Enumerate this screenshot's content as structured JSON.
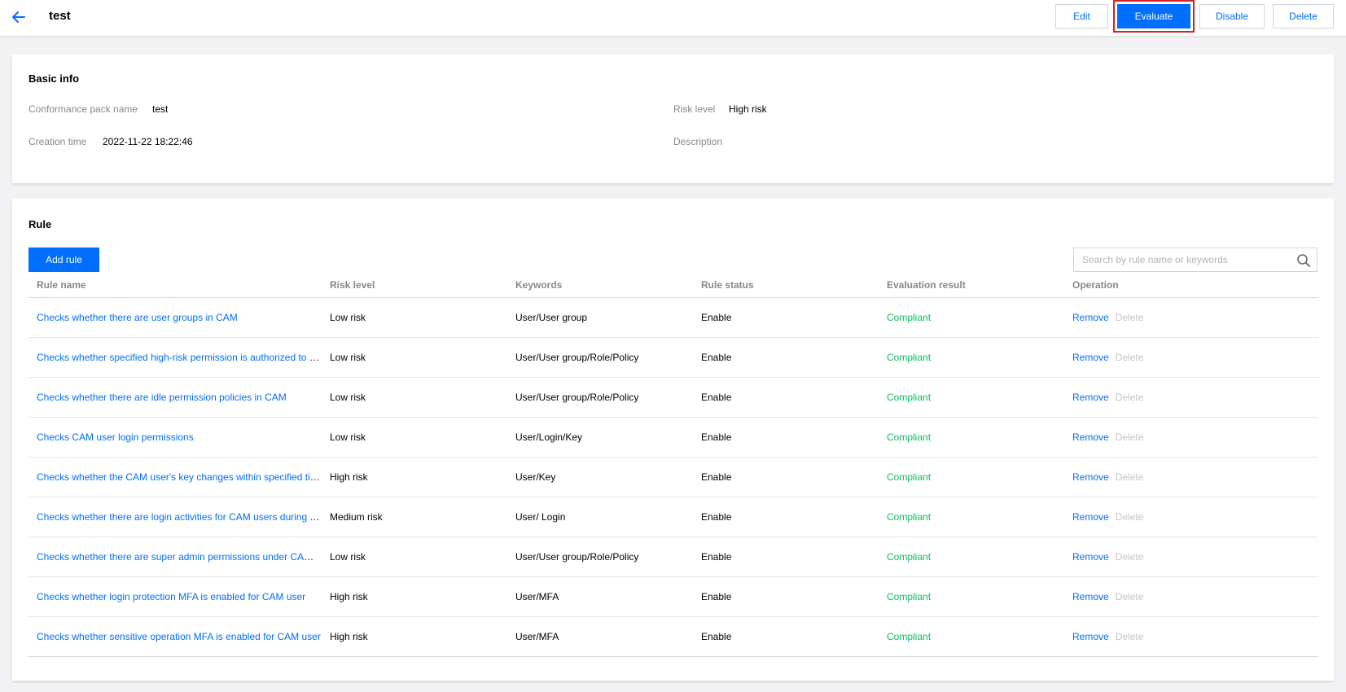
{
  "header": {
    "title": "test",
    "buttons": {
      "edit": "Edit",
      "evaluate": "Evaluate",
      "disable": "Disable",
      "delete": "Delete"
    }
  },
  "basic_info": {
    "title": "Basic info",
    "pack_name_label": "Conformance pack name",
    "pack_name_value": "test",
    "risk_level_label": "Risk level",
    "risk_level_value": "High risk",
    "creation_time_label": "Creation time",
    "creation_time_value": "2022-11-22 18:22:46",
    "description_label": "Description"
  },
  "rule_section": {
    "title": "Rule",
    "add_rule_label": "Add rule",
    "search_placeholder": "Search by rule name or keywords",
    "columns": [
      "Rule name",
      "Risk level",
      "Keywords",
      "Rule status",
      "Evaluation result",
      "Operation"
    ],
    "remove_label": "Remove",
    "delete_label": "Delete",
    "rows": [
      {
        "name": "Checks whether there are user groups in CAM",
        "risk": "Low risk",
        "keywords": "User/User group",
        "status": "Enable",
        "result": "Compliant"
      },
      {
        "name": "Checks whether specified high-risk permission is authorized to CA...",
        "risk": "Low risk",
        "keywords": "User/User group/Role/Policy",
        "status": "Enable",
        "result": "Compliant"
      },
      {
        "name": "Checks whether there are idle permission policies in CAM",
        "risk": "Low risk",
        "keywords": "User/User group/Role/Policy",
        "status": "Enable",
        "result": "Compliant"
      },
      {
        "name": "Checks CAM user login permissions",
        "risk": "Low risk",
        "keywords": "User/Login/Key",
        "status": "Enable",
        "result": "Compliant"
      },
      {
        "name": "Checks whether the CAM user's key changes within specified time",
        "risk": "High risk",
        "keywords": "User/Key",
        "status": "Enable",
        "result": "Compliant"
      },
      {
        "name": "Checks whether there are login activities for CAM users during spe...",
        "risk": "Medium risk",
        "keywords": "User/ Login",
        "status": "Enable",
        "result": "Compliant"
      },
      {
        "name": "Checks whether there are super admin permissions under CAM su...",
        "risk": "Low risk",
        "keywords": "User/User group/Role/Policy",
        "status": "Enable",
        "result": "Compliant"
      },
      {
        "name": "Checks whether login protection MFA is enabled for CAM user",
        "risk": "High risk",
        "keywords": "User/MFA",
        "status": "Enable",
        "result": "Compliant"
      },
      {
        "name": "Checks whether sensitive operation MFA is enabled for CAM user",
        "risk": "High risk",
        "keywords": "User/MFA",
        "status": "Enable",
        "result": "Compliant"
      }
    ]
  },
  "colors": {
    "accent": "#006eff",
    "compliant": "#0abf5b",
    "highlight_border": "#d8202a",
    "disabled_text": "#c4c4c4"
  },
  "icons": {
    "back": "arrow-left-icon",
    "search": "search-icon"
  }
}
